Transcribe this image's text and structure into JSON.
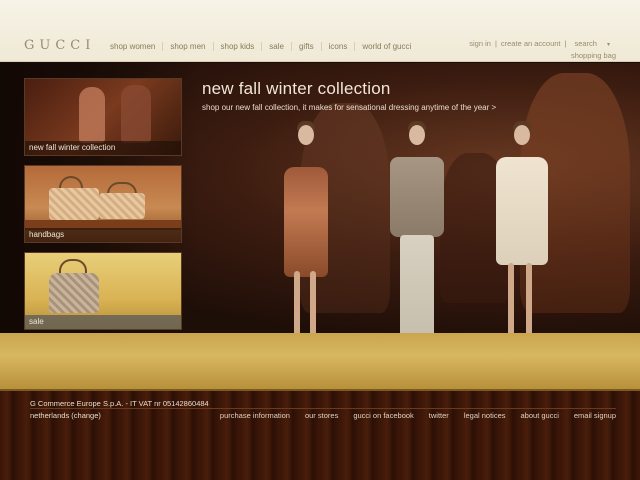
{
  "header": {
    "logo": "GUCCI",
    "nav": [
      "shop women",
      "shop men",
      "shop kids",
      "sale",
      "gifts",
      "icons",
      "world of gucci"
    ],
    "util": {
      "sign_in": "sign in",
      "create_account": "create an account",
      "search": "search",
      "shopping_bag": "shopping bag"
    }
  },
  "hero": {
    "title": "new fall winter collection",
    "subtitle": "shop our new fall collection, it makes for sensational dressing anytime of the year >"
  },
  "tiles": [
    {
      "label": "new fall winter collection"
    },
    {
      "label": "handbags"
    },
    {
      "label": "sale"
    }
  ],
  "footer": {
    "company": "G Commerce Europe S.p.A. - IT VAT nr 05142860484",
    "region": "netherlands (change)",
    "links": [
      "purchase information",
      "our stores",
      "gucci on facebook",
      "twitter",
      "legal notices",
      "about gucci",
      "email signup"
    ]
  },
  "colors": {
    "header_bg": "#f7f3e6",
    "nav_text": "#8a7a5a",
    "hero_text": "#f2e6d6",
    "stage_gold": "#d7b760",
    "footer_wood": "#3a1608"
  }
}
